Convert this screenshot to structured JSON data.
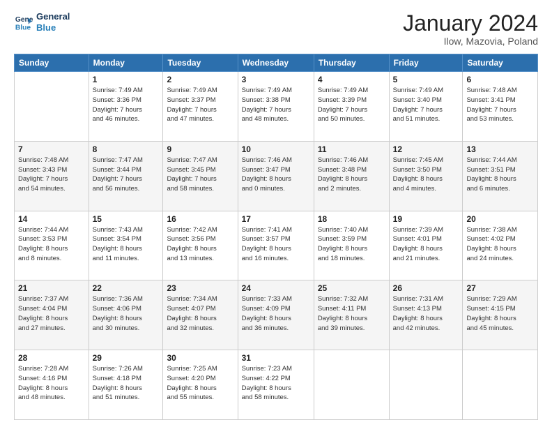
{
  "header": {
    "logo": {
      "line1": "General",
      "line2": "Blue"
    },
    "title": "January 2024",
    "subtitle": "Ilow, Mazovia, Poland"
  },
  "weekdays": [
    "Sunday",
    "Monday",
    "Tuesday",
    "Wednesday",
    "Thursday",
    "Friday",
    "Saturday"
  ],
  "weeks": [
    [
      {
        "day": "",
        "info": ""
      },
      {
        "day": "1",
        "info": "Sunrise: 7:49 AM\nSunset: 3:36 PM\nDaylight: 7 hours\nand 46 minutes."
      },
      {
        "day": "2",
        "info": "Sunrise: 7:49 AM\nSunset: 3:37 PM\nDaylight: 7 hours\nand 47 minutes."
      },
      {
        "day": "3",
        "info": "Sunrise: 7:49 AM\nSunset: 3:38 PM\nDaylight: 7 hours\nand 48 minutes."
      },
      {
        "day": "4",
        "info": "Sunrise: 7:49 AM\nSunset: 3:39 PM\nDaylight: 7 hours\nand 50 minutes."
      },
      {
        "day": "5",
        "info": "Sunrise: 7:49 AM\nSunset: 3:40 PM\nDaylight: 7 hours\nand 51 minutes."
      },
      {
        "day": "6",
        "info": "Sunrise: 7:48 AM\nSunset: 3:41 PM\nDaylight: 7 hours\nand 53 minutes."
      }
    ],
    [
      {
        "day": "7",
        "info": "Sunrise: 7:48 AM\nSunset: 3:43 PM\nDaylight: 7 hours\nand 54 minutes."
      },
      {
        "day": "8",
        "info": "Sunrise: 7:47 AM\nSunset: 3:44 PM\nDaylight: 7 hours\nand 56 minutes."
      },
      {
        "day": "9",
        "info": "Sunrise: 7:47 AM\nSunset: 3:45 PM\nDaylight: 7 hours\nand 58 minutes."
      },
      {
        "day": "10",
        "info": "Sunrise: 7:46 AM\nSunset: 3:47 PM\nDaylight: 8 hours\nand 0 minutes."
      },
      {
        "day": "11",
        "info": "Sunrise: 7:46 AM\nSunset: 3:48 PM\nDaylight: 8 hours\nand 2 minutes."
      },
      {
        "day": "12",
        "info": "Sunrise: 7:45 AM\nSunset: 3:50 PM\nDaylight: 8 hours\nand 4 minutes."
      },
      {
        "day": "13",
        "info": "Sunrise: 7:44 AM\nSunset: 3:51 PM\nDaylight: 8 hours\nand 6 minutes."
      }
    ],
    [
      {
        "day": "14",
        "info": "Sunrise: 7:44 AM\nSunset: 3:53 PM\nDaylight: 8 hours\nand 8 minutes."
      },
      {
        "day": "15",
        "info": "Sunrise: 7:43 AM\nSunset: 3:54 PM\nDaylight: 8 hours\nand 11 minutes."
      },
      {
        "day": "16",
        "info": "Sunrise: 7:42 AM\nSunset: 3:56 PM\nDaylight: 8 hours\nand 13 minutes."
      },
      {
        "day": "17",
        "info": "Sunrise: 7:41 AM\nSunset: 3:57 PM\nDaylight: 8 hours\nand 16 minutes."
      },
      {
        "day": "18",
        "info": "Sunrise: 7:40 AM\nSunset: 3:59 PM\nDaylight: 8 hours\nand 18 minutes."
      },
      {
        "day": "19",
        "info": "Sunrise: 7:39 AM\nSunset: 4:01 PM\nDaylight: 8 hours\nand 21 minutes."
      },
      {
        "day": "20",
        "info": "Sunrise: 7:38 AM\nSunset: 4:02 PM\nDaylight: 8 hours\nand 24 minutes."
      }
    ],
    [
      {
        "day": "21",
        "info": "Sunrise: 7:37 AM\nSunset: 4:04 PM\nDaylight: 8 hours\nand 27 minutes."
      },
      {
        "day": "22",
        "info": "Sunrise: 7:36 AM\nSunset: 4:06 PM\nDaylight: 8 hours\nand 30 minutes."
      },
      {
        "day": "23",
        "info": "Sunrise: 7:34 AM\nSunset: 4:07 PM\nDaylight: 8 hours\nand 32 minutes."
      },
      {
        "day": "24",
        "info": "Sunrise: 7:33 AM\nSunset: 4:09 PM\nDaylight: 8 hours\nand 36 minutes."
      },
      {
        "day": "25",
        "info": "Sunrise: 7:32 AM\nSunset: 4:11 PM\nDaylight: 8 hours\nand 39 minutes."
      },
      {
        "day": "26",
        "info": "Sunrise: 7:31 AM\nSunset: 4:13 PM\nDaylight: 8 hours\nand 42 minutes."
      },
      {
        "day": "27",
        "info": "Sunrise: 7:29 AM\nSunset: 4:15 PM\nDaylight: 8 hours\nand 45 minutes."
      }
    ],
    [
      {
        "day": "28",
        "info": "Sunrise: 7:28 AM\nSunset: 4:16 PM\nDaylight: 8 hours\nand 48 minutes."
      },
      {
        "day": "29",
        "info": "Sunrise: 7:26 AM\nSunset: 4:18 PM\nDaylight: 8 hours\nand 51 minutes."
      },
      {
        "day": "30",
        "info": "Sunrise: 7:25 AM\nSunset: 4:20 PM\nDaylight: 8 hours\nand 55 minutes."
      },
      {
        "day": "31",
        "info": "Sunrise: 7:23 AM\nSunset: 4:22 PM\nDaylight: 8 hours\nand 58 minutes."
      },
      {
        "day": "",
        "info": ""
      },
      {
        "day": "",
        "info": ""
      },
      {
        "day": "",
        "info": ""
      }
    ]
  ]
}
